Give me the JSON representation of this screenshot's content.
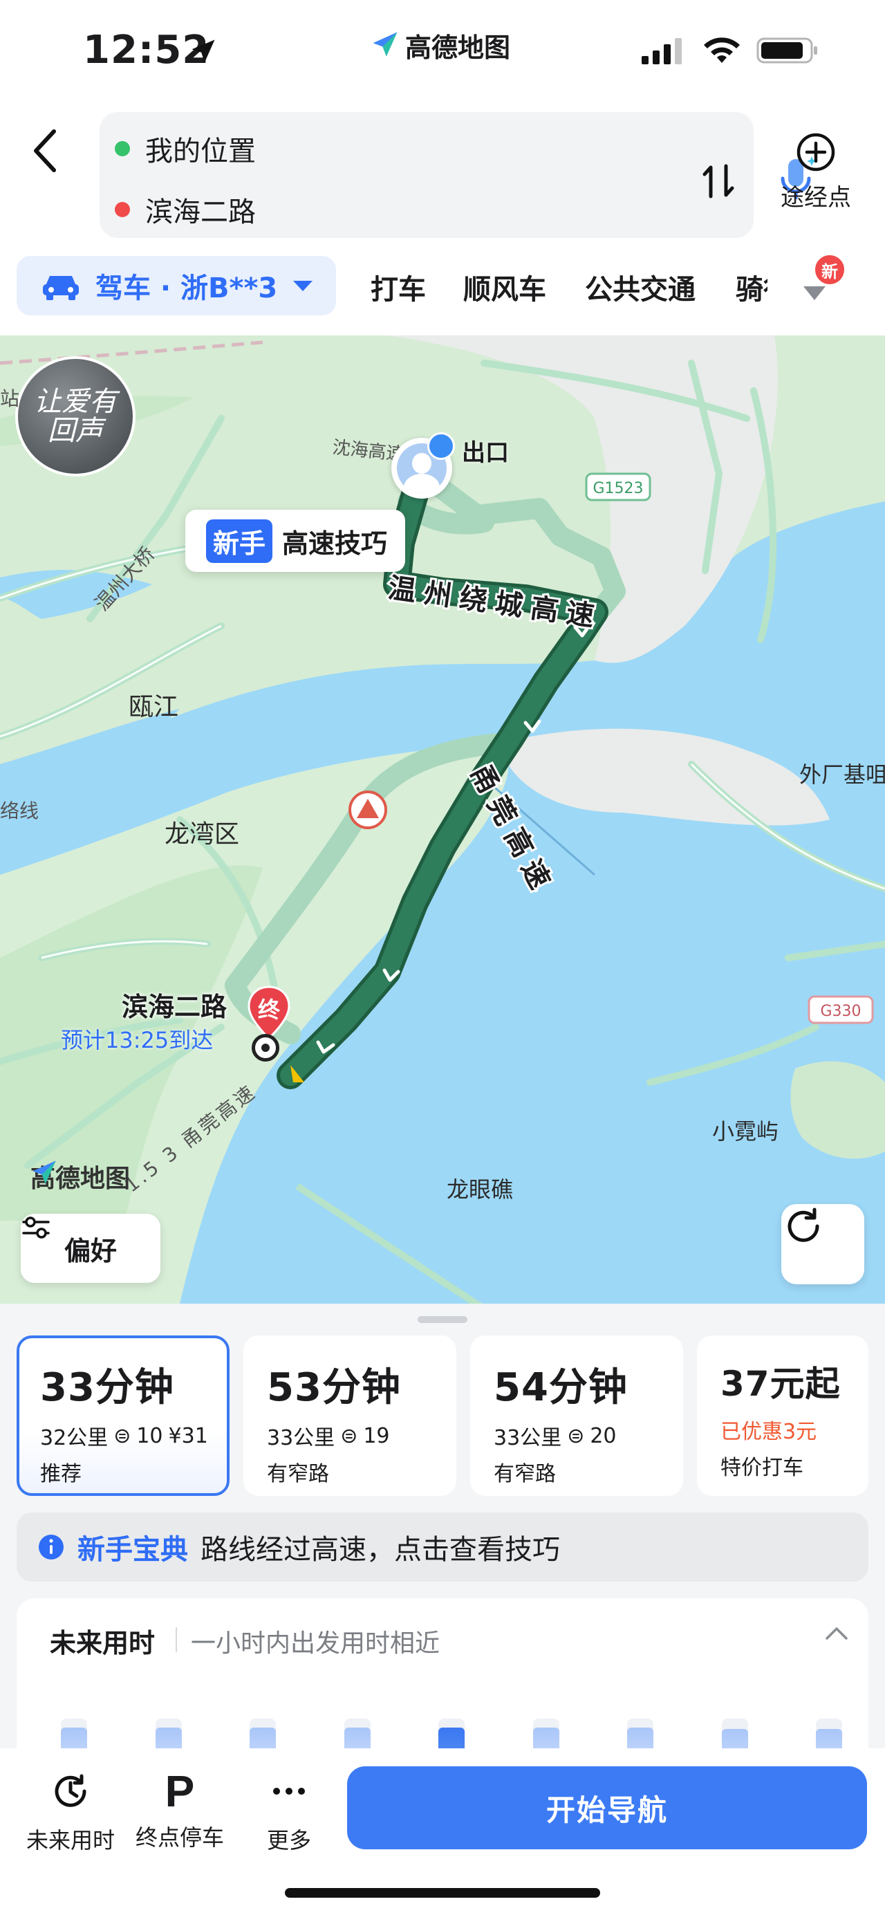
{
  "status_bar": {
    "time": "12:52",
    "app_name": "高德地图"
  },
  "route_input": {
    "origin": "我的位置",
    "destination": "滨海二路",
    "origin_color": "#35c26b",
    "destination_color": "#f04a4a",
    "waypoint_label": "途经点"
  },
  "mode_tabs": {
    "active_label": "驾车 · 浙B**3",
    "tabs": [
      "打车",
      "顺风车",
      "公共交通",
      "骑行"
    ],
    "new_badge": "新"
  },
  "map": {
    "promo_text": "让爱有回声",
    "tip": {
      "badge": "新手",
      "text": "高速技巧"
    },
    "exit_label": "出口",
    "highway_label_1": "温州绕城高速",
    "highway_label_2": "甬莞高速",
    "road_label_top": "沈海高速",
    "road_label_bottom": "1.5 3 甬莞高速",
    "place_labels": {
      "wenzhou_bridge": "温州大桥",
      "oujiang": "瓯江",
      "longwan": "龙湾区",
      "waichang": "外厂基咀",
      "xiaonixu": "小霓屿",
      "longyanjiao": "龙眼礁",
      "luoxian": "络线",
      "zhan": "站"
    },
    "shields": [
      "G1523",
      "G330"
    ],
    "dest_marker": "终",
    "dest_name": "滨海二路",
    "eta": "预计13:25到达",
    "watermark": "高德地图",
    "pref_label": "偏好"
  },
  "routes": [
    {
      "duration": "33分钟",
      "distance": "32公里",
      "lights": "10",
      "toll": "¥31",
      "tag": "推荐",
      "selected": true
    },
    {
      "duration": "53分钟",
      "distance": "33公里",
      "lights": "19",
      "toll": "",
      "tag": "有窄路",
      "selected": false
    },
    {
      "duration": "54分钟",
      "distance": "33公里",
      "lights": "20",
      "toll": "",
      "tag": "有窄路",
      "selected": false
    },
    {
      "duration": "37元起",
      "discount": "已优惠3元",
      "tag": "特价打车",
      "selected": false
    }
  ],
  "tips_banner": {
    "highlight": "新手宝典",
    "text": "路线经过高速，点击查看技巧"
  },
  "future_time": {
    "title": "未来用时",
    "subtitle": "一小时内出发用时相近",
    "bars": [
      0.9,
      0.9,
      0.9,
      0.9,
      0.9,
      0.9,
      0.9,
      0.88,
      0.88
    ],
    "active_index": 4
  },
  "toolbar": {
    "future_time_label": "未来用时",
    "parking_label": "终点停车",
    "parking_glyph": "P",
    "more_label": "更多",
    "start_label": "开始导航"
  },
  "colors": {
    "accent": "#2f6df6",
    "route_main": "#2e7d5b",
    "route_alt": "#a9d7bd"
  }
}
